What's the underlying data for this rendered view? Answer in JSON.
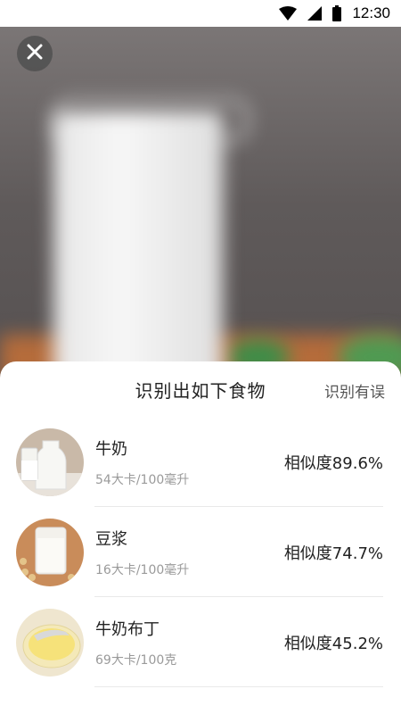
{
  "status_bar": {
    "time": "12:30"
  },
  "sheet": {
    "title": "识别出如下食物",
    "wrong_link": "识别有误"
  },
  "foods": [
    {
      "name": "牛奶",
      "calories": "54大卡/100毫升",
      "similarity": "相似度89.6%"
    },
    {
      "name": "豆浆",
      "calories": "16大卡/100毫升",
      "similarity": "相似度74.7%"
    },
    {
      "name": "牛奶布丁",
      "calories": "69大卡/100克",
      "similarity": "相似度45.2%"
    }
  ]
}
